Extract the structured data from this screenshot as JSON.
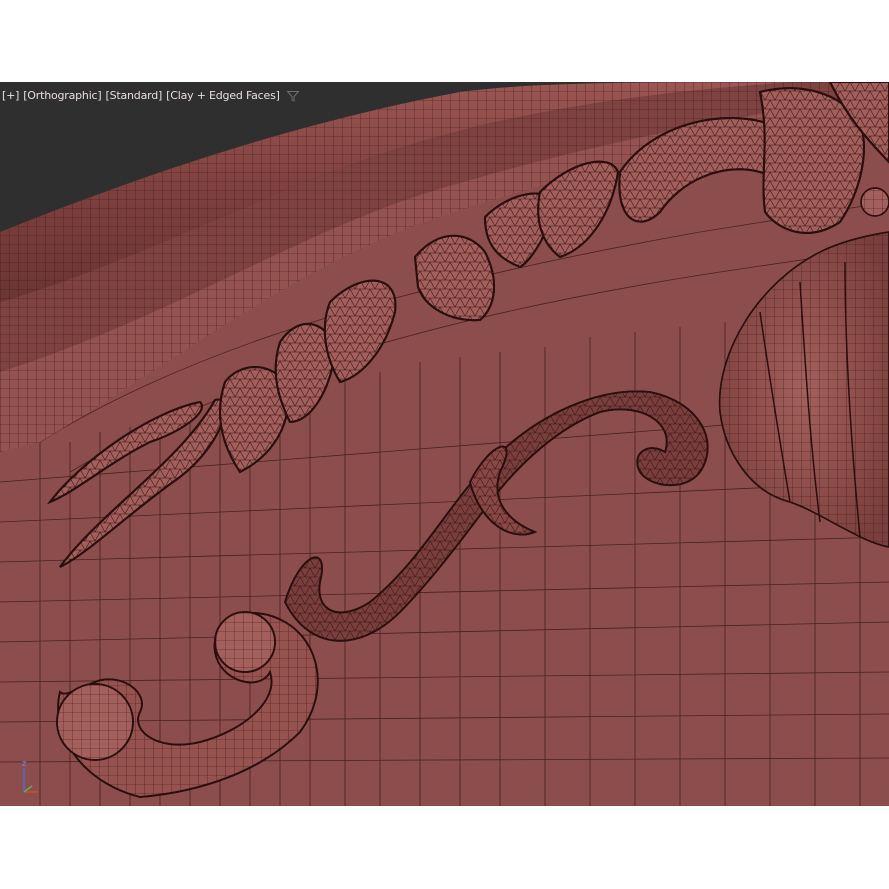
{
  "viewport": {
    "labels": {
      "plus": "[+]",
      "view": "[Orthographic]",
      "shading": "[Standard]",
      "style": "[Clay + Edged Faces]"
    },
    "filter_icon": "filter-funnel-icon",
    "gizmo": {
      "axis_label": "z"
    }
  },
  "colors": {
    "background": "#2f2f2f",
    "clay": "#8b4e4c",
    "clay_light": "#a8625e",
    "wire": "#3b1a19",
    "label_text": "#e9dede"
  }
}
